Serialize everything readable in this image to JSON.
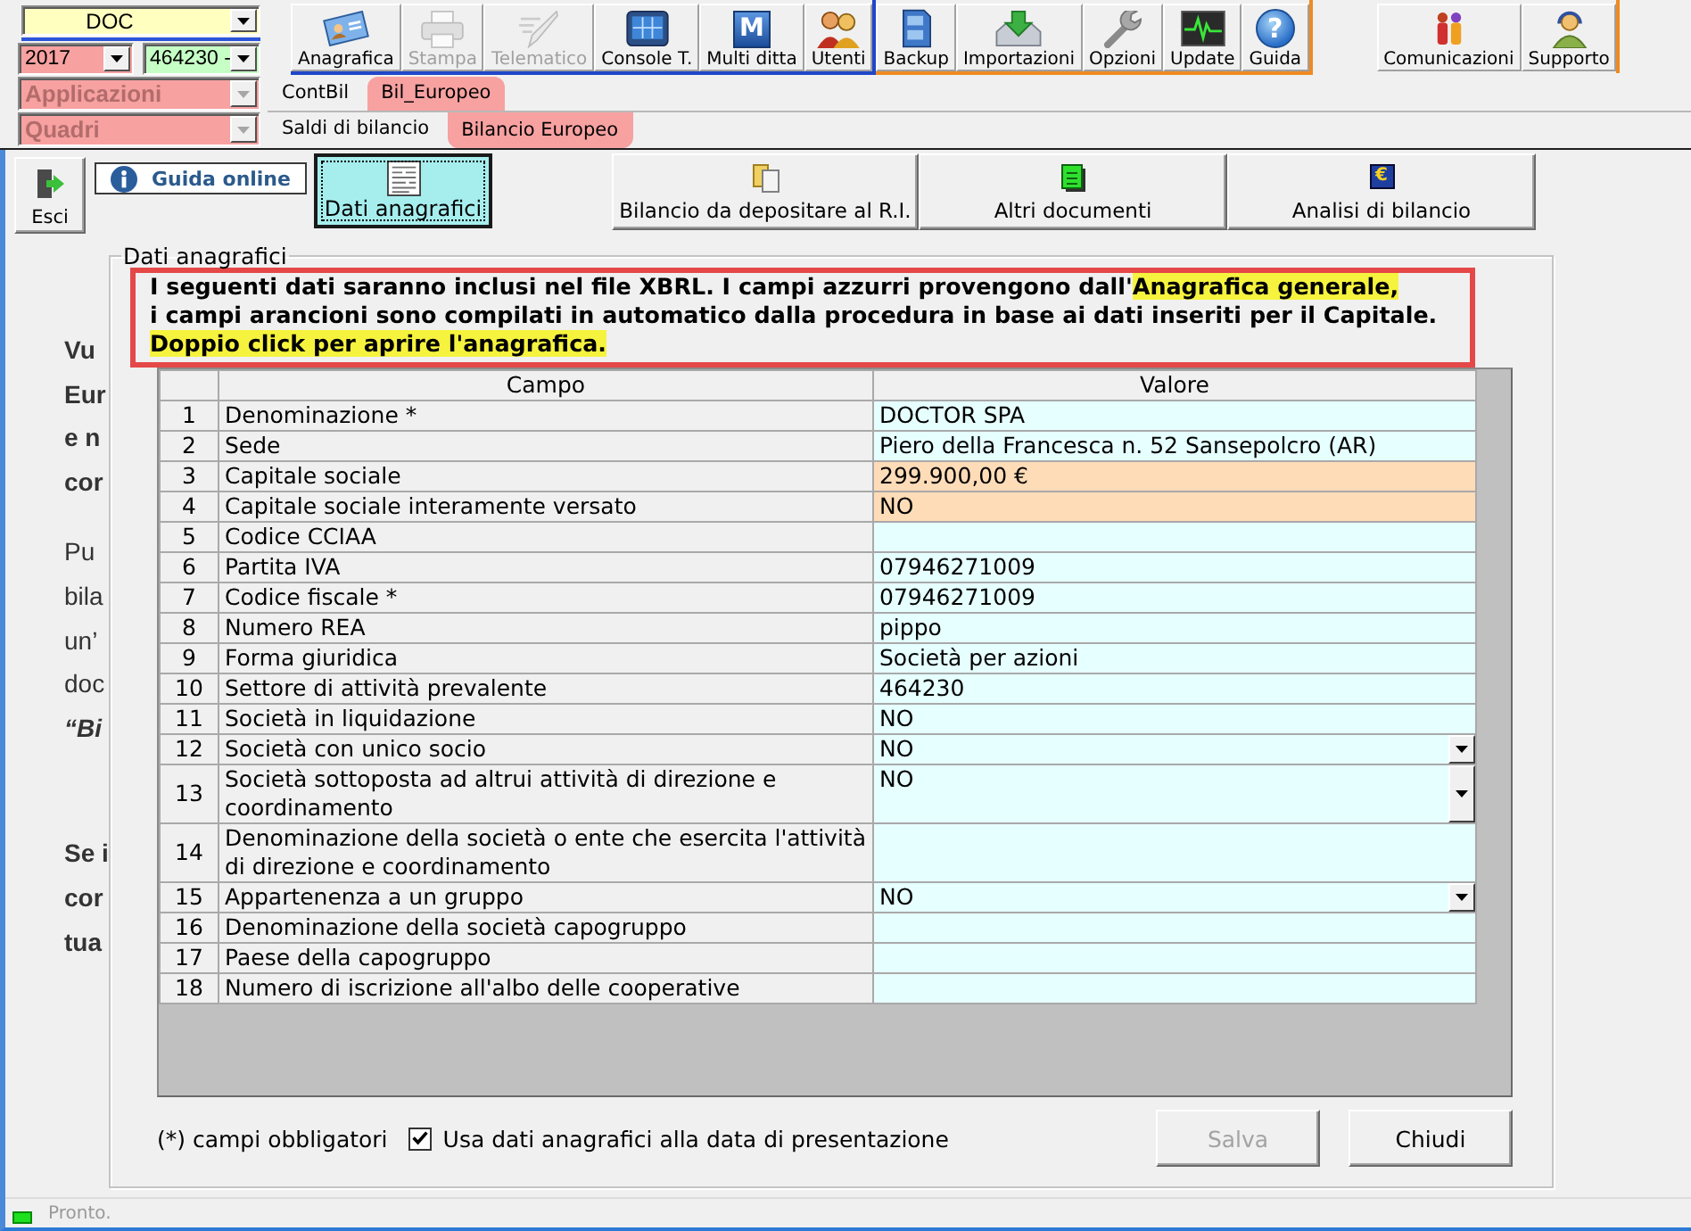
{
  "selectors": [
    {
      "value": "DOC",
      "color": "#ffffc0",
      "disabled": false
    },
    {
      "value": "2017",
      "color": "#f7a1a1",
      "disabled": false
    },
    {
      "value": "464230 -",
      "color": "#c6ffc6",
      "disabled": false
    },
    {
      "value": "Applicazioni",
      "color": "#f7a1a1",
      "disabled": true
    },
    {
      "value": "Quadri",
      "color": "#f7a1a1",
      "disabled": true
    }
  ],
  "toolbar": [
    [
      {
        "label": "Anagrafica",
        "kind": "card",
        "disabled": false
      },
      {
        "label": "Stampa",
        "kind": "printer",
        "disabled": true
      },
      {
        "label": "Telematico",
        "kind": "quill",
        "disabled": true
      },
      {
        "label": "Console T.",
        "kind": "console",
        "disabled": false
      },
      {
        "label": "Multi ditta",
        "kind": "letter",
        "glyph": "M",
        "disabled": false
      },
      {
        "label": "Utenti",
        "kind": "users",
        "disabled": false
      }
    ],
    [
      {
        "label": "Backup",
        "kind": "cabinet",
        "disabled": false
      },
      {
        "label": "Importazioni",
        "kind": "import",
        "disabled": false
      },
      {
        "label": "Opzioni",
        "kind": "wrench",
        "disabled": false
      },
      {
        "label": "Update",
        "kind": "pulse",
        "disabled": false
      },
      {
        "label": "Guida",
        "kind": "help",
        "glyph": "?",
        "disabled": false
      }
    ],
    [
      {
        "label": "Comunicazioni",
        "kind": "people",
        "disabled": false
      },
      {
        "label": "Supporto",
        "kind": "support",
        "disabled": false
      }
    ]
  ],
  "tabs": [
    {
      "label": "ContBil",
      "selected": false
    },
    {
      "label": "Bil_Europeo",
      "selected": true
    }
  ],
  "subtabs": [
    {
      "label": "Saldi di bilancio",
      "selected": false
    },
    {
      "label": "Bilancio Europeo",
      "selected": true
    }
  ],
  "exit_button": {
    "label": "Esci"
  },
  "help_link": {
    "label": "Guida online"
  },
  "sections": [
    {
      "label": "Dati anagrafici",
      "kind": "form",
      "selected": true
    },
    {
      "label": "Bilancio da depositare al R.I.",
      "kind": "folder",
      "selected": false
    },
    {
      "label": "Altri documenti",
      "kind": "sheet",
      "selected": false
    },
    {
      "label": "Analisi di bilancio",
      "kind": "euro",
      "glyph": "€",
      "selected": false
    }
  ],
  "background_text": [
    [
      "Vu",
      "Eur",
      "e n",
      "cor"
    ],
    [
      "Pu",
      "bila",
      "un’",
      "doc",
      "“Bi"
    ],
    [
      "Se i",
      "cor",
      "tua"
    ]
  ],
  "dialog": {
    "title": "Dati anagrafici",
    "notice": {
      "lines": [
        [
          {
            "text": "I seguenti dati saranno inclusi nel file XBRL. I campi azzurri provengono dall'",
            "highlight": false
          },
          {
            "text": "Anagrafica generale,",
            "highlight": true
          }
        ],
        [
          {
            "text": "i campi arancioni sono compilati in automatico dalla procedura in base ai dati inseriti per il Capitale.",
            "highlight": false
          }
        ],
        [
          {
            "text": "Doppio click per aprire l'anagrafica.",
            "highlight": true
          }
        ]
      ]
    },
    "table": {
      "columns": [
        "Campo",
        "Valore"
      ],
      "rows": [
        {
          "number": "1",
          "field": "Denominazione *",
          "value": "DOCTOR SPA",
          "kind": "registry",
          "dropdown": false
        },
        {
          "number": "2",
          "field": "Sede",
          "value": "Piero della Francesca n. 52 Sansepolcro (AR)",
          "kind": "registry",
          "dropdown": false
        },
        {
          "number": "3",
          "field": "Capitale sociale",
          "value": "299.900,00 €",
          "kind": "computed",
          "dropdown": false
        },
        {
          "number": "4",
          "field": "Capitale sociale interamente versato",
          "value": "NO",
          "kind": "computed",
          "dropdown": false
        },
        {
          "number": "5",
          "field": "Codice CCIAA",
          "kind": "registry",
          "dropdown": false
        },
        {
          "number": "6",
          "field": "Partita IVA",
          "value": "07946271009",
          "kind": "registry",
          "dropdown": false
        },
        {
          "number": "7",
          "field": "Codice fiscale *",
          "value": "07946271009",
          "kind": "registry",
          "dropdown": false
        },
        {
          "number": "8",
          "field": "Numero REA",
          "value": "pippo",
          "kind": "registry",
          "dropdown": false
        },
        {
          "number": "9",
          "field": "Forma giuridica",
          "value": "Società per azioni",
          "kind": "registry",
          "dropdown": false
        },
        {
          "number": "10",
          "field": "Settore di attività prevalente",
          "value": "464230",
          "kind": "registry",
          "dropdown": false
        },
        {
          "number": "11",
          "field": "Società in liquidazione",
          "value": "NO",
          "kind": "registry",
          "dropdown": false
        },
        {
          "number": "12",
          "field": "Società con unico socio",
          "value": "NO",
          "kind": "registry",
          "dropdown": true
        },
        {
          "number": "13",
          "field": "Società sottoposta ad altrui attività di direzione e coordinamento",
          "value": "NO",
          "kind": "registry",
          "dropdown": true
        },
        {
          "number": "14",
          "field": "Denominazione della società o ente che esercita l'attività di direzione e coordinamento",
          "kind": "registry",
          "dropdown": false
        },
        {
          "number": "15",
          "field": "Appartenenza a un gruppo",
          "value": "NO",
          "kind": "registry",
          "dropdown": true
        },
        {
          "number": "16",
          "field": "Denominazione della società capogruppo",
          "kind": "registry",
          "dropdown": false
        },
        {
          "number": "17",
          "field": "Paese della capogruppo",
          "kind": "registry",
          "dropdown": false
        },
        {
          "number": "18",
          "field": "Numero di iscrizione all'albo delle cooperative",
          "kind": "registry",
          "dropdown": false
        }
      ]
    },
    "footnote": "(*) campi obbligatori",
    "checkbox": {
      "label": "Usa dati anagrafici alla data di presentazione",
      "checked": true
    },
    "buttons": [
      {
        "label": "Salva",
        "disabled": true
      },
      {
        "label": "Chiudi",
        "disabled": false
      }
    ]
  },
  "status_bar": {
    "text": "Pronto."
  }
}
